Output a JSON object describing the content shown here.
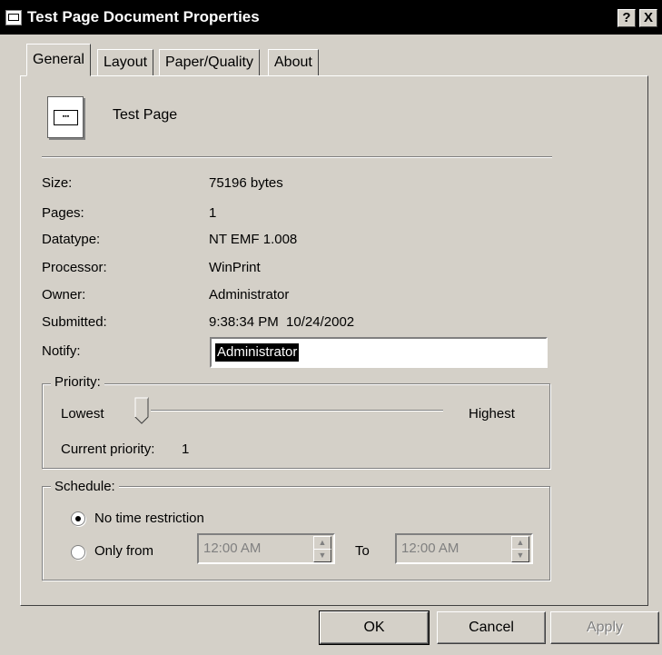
{
  "window": {
    "title": "Test Page Document Properties",
    "help_label": "?",
    "close_label": "X"
  },
  "tabs": [
    {
      "label": "General",
      "active": true
    },
    {
      "label": "Layout"
    },
    {
      "label": "Paper/Quality"
    },
    {
      "label": "About"
    }
  ],
  "document": {
    "name": "Test Page",
    "icon": "document-icon"
  },
  "properties": [
    {
      "label": "Size:",
      "value": "75196 bytes"
    },
    {
      "label": "Pages:",
      "value": "1"
    },
    {
      "label": "Datatype:",
      "value": "NT EMF 1.008"
    },
    {
      "label": "Processor:",
      "value": "WinPrint"
    },
    {
      "label": "Owner:",
      "value": "Administrator"
    },
    {
      "label": "Submitted:",
      "value": "9:38:34 PM  10/24/2002"
    }
  ],
  "notify": {
    "label": "Notify:",
    "value": "Administrator"
  },
  "priority": {
    "group_label": "Priority:",
    "low_label": "Lowest",
    "high_label": "Highest",
    "current_label": "Current priority:",
    "current_value": "1",
    "level": 0
  },
  "schedule": {
    "group_label": "Schedule:",
    "no_restriction_label": "No time restriction",
    "only_from_label": "Only from",
    "to_label": "To",
    "from_time": "12:00 AM",
    "to_time": "12:00 AM",
    "selected": "no_restriction"
  },
  "buttons": {
    "ok": "OK",
    "cancel": "Cancel",
    "apply": "Apply"
  }
}
